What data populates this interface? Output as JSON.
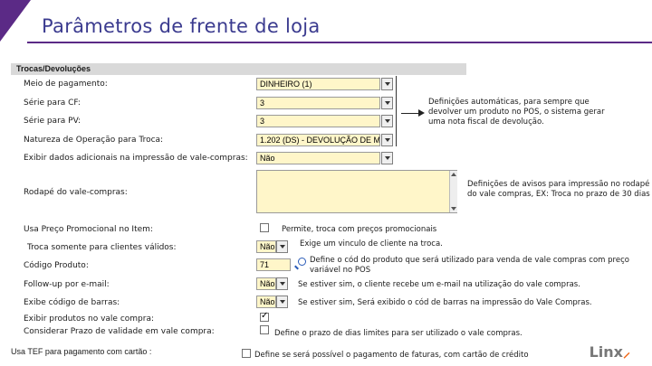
{
  "page": {
    "title": "Parâmetros de frente de loja"
  },
  "section": {
    "title": "Trocas/Devoluções"
  },
  "form": {
    "meio_pagamento": {
      "label": "Meio de pagamento:",
      "value": "DINHEIRO (1)"
    },
    "serie_cf": {
      "label": "Série para CF:",
      "value": "3"
    },
    "serie_pv": {
      "label": "Série para PV:",
      "value": "3"
    },
    "natureza": {
      "label": "Natureza de Operação para Troca:",
      "value": "1.202 (DS) - DEVOLUÇÃO DE M"
    },
    "exibir_dados": {
      "label": "Exibir dados adicionais na impressão de vale-compras:",
      "value": "Não"
    },
    "rodape": {
      "label": "Rodapé do vale-compras:",
      "value": ""
    },
    "preco_promo": {
      "label": "Usa Preço Promocional no Item:",
      "checked": false
    },
    "troca_validos": {
      "label": "Troca somente para clientes válidos:",
      "value": "Não"
    },
    "codigo_produto": {
      "label": "Código Produto:",
      "value": "71"
    },
    "followup": {
      "label": "Follow-up por e-mail:",
      "value": "Não"
    },
    "codigo_barras": {
      "label": "Exibe código de barras:",
      "value": "Não"
    },
    "exibir_produtos": {
      "label": "Exibir produtos no vale compra:",
      "checked": true
    },
    "prazo_validade": {
      "label": "Considerar Prazo de validade em vale compra:",
      "checked": false
    },
    "tef": {
      "label": "Usa TEF para pagamento com cartão :",
      "checked": false
    }
  },
  "notes": {
    "automaticas": "Definições automáticas, para sempre que devolver um produto no POS, o sistema gerar uma nota fiscal de devolução.",
    "avisos": "Definições de avisos para impressão no rodapé do vale compras, EX: Troca no prazo de 30 dias",
    "permite": "Permite, troca com preços promocionais",
    "exige": "Exige um vinculo de cliente na troca.",
    "cod_produto": "Define o cód do produto que será utilizado para venda de vale compras com preço variável no POS",
    "followup": "Se estiver sim, o cliente recebe um e-mail na utilização do vale compras.",
    "barras": "Se estiver sim, Será exibido o cód de barras na impressão do Vale Compras.",
    "prazo": "Define o prazo de dias limites para ser utilizado o vale compras.",
    "tef": "Define se será possível o pagamento de faturas, com cartão de crédito"
  },
  "logo": {
    "text": "Linx",
    "accent": "#f26a1b"
  },
  "colors": {
    "brand": "#5b2a86",
    "field_bg": "#fff6c9",
    "title": "#3b3b8f"
  }
}
